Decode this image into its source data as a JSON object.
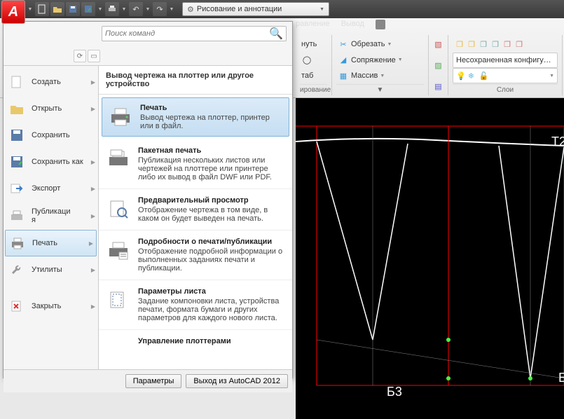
{
  "workspace_label": "Рисование и аннотации",
  "search_placeholder": "Поиск команд",
  "ribbon_tabs": [
    "равление",
    "Вывод"
  ],
  "ribbon": {
    "tab_vis": "таб",
    "btn_nut": "нуть",
    "trim": "Обрезать",
    "fillet": "Сопряжение",
    "array": "Массив",
    "group_draw": "ирование",
    "layers_unsaved": "Несохраненная конфигурация сло",
    "group_layers": "Слои"
  },
  "menu_left": [
    {
      "label": "Создать"
    },
    {
      "label": "Открыть"
    },
    {
      "label": "Сохранить"
    },
    {
      "label": "Сохранить как"
    },
    {
      "label": "Экспорт"
    },
    {
      "label": "Публикаци я"
    },
    {
      "label": "Печать"
    },
    {
      "label": "Утилиты"
    },
    {
      "label": "Закрыть"
    }
  ],
  "menu_right_title": "Вывод чертежа на плоттер или другое устройство",
  "menu_right": [
    {
      "title": "Печать",
      "desc": "Вывод чертежа на плоттер, принтер или в файл."
    },
    {
      "title": "Пакетная печать",
      "desc": "Публикация нескольких листов или чертежей на плоттере или принтере либо их вывод в файл DWF или PDF."
    },
    {
      "title": "Предварительный просмотр",
      "desc": "Отображение чертежа в том виде, в каком он будет выведен на печать."
    },
    {
      "title": "Подробности о печати/публикации",
      "desc": "Отображение подробной информации о выполненных заданиях печати и публикации."
    },
    {
      "title": "Параметры листа",
      "desc": "Задание компоновки листа, устройства печати, формата бумаги и других параметров для каждого нового листа."
    },
    {
      "title": "Управление плоттерами",
      "desc": ""
    }
  ],
  "footer": {
    "options": "Параметры",
    "exit": "Выход из AutoCAD 2012"
  },
  "canvas_labels": {
    "t2": "Т2",
    "b": "Б",
    "b3": "Б3"
  }
}
